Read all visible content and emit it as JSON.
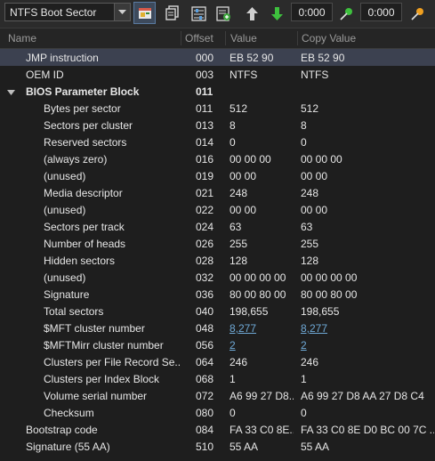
{
  "toolbar": {
    "template_select": "NTFS Boot Sector",
    "number_left": "0:000",
    "number_right": "0:000",
    "icons": [
      "template-icon",
      "copy-icon",
      "settings-icon",
      "export-icon",
      "up-icon",
      "down-icon",
      "pin-green-icon",
      "pin-orange-icon"
    ]
  },
  "columns": {
    "name": "Name",
    "offset": "Offset",
    "value": "Value",
    "copy_value": "Copy Value"
  },
  "rows": [
    {
      "name": "JMP instruction",
      "offset": "000",
      "value": "EB 52 90",
      "copy": "EB 52 90",
      "level": 1,
      "selected": true
    },
    {
      "name": "OEM ID",
      "offset": "003",
      "value": "NTFS",
      "copy": "NTFS",
      "level": 1
    },
    {
      "name": "BIOS Parameter Block",
      "offset": "011",
      "value": "",
      "copy": "",
      "level": 0,
      "group": true
    },
    {
      "name": "Bytes per sector",
      "offset": "011",
      "value": "512",
      "copy": "512",
      "level": 2
    },
    {
      "name": "Sectors per cluster",
      "offset": "013",
      "value": "8",
      "copy": "8",
      "level": 2
    },
    {
      "name": "Reserved sectors",
      "offset": "014",
      "value": "0",
      "copy": "0",
      "level": 2
    },
    {
      "name": "(always zero)",
      "offset": "016",
      "value": "00 00 00",
      "copy": "00 00 00",
      "level": 2
    },
    {
      "name": "(unused)",
      "offset": "019",
      "value": "00 00",
      "copy": "00 00",
      "level": 2
    },
    {
      "name": "Media descriptor",
      "offset": "021",
      "value": "248",
      "copy": "248",
      "level": 2
    },
    {
      "name": "(unused)",
      "offset": "022",
      "value": "00 00",
      "copy": "00 00",
      "level": 2
    },
    {
      "name": "Sectors per track",
      "offset": "024",
      "value": "63",
      "copy": "63",
      "level": 2
    },
    {
      "name": "Number of heads",
      "offset": "026",
      "value": "255",
      "copy": "255",
      "level": 2
    },
    {
      "name": "Hidden sectors",
      "offset": "028",
      "value": "128",
      "copy": "128",
      "level": 2
    },
    {
      "name": "(unused)",
      "offset": "032",
      "value": "00 00 00 00",
      "copy": "00 00 00 00",
      "level": 2
    },
    {
      "name": "Signature",
      "offset": "036",
      "value": "80 00 80 00",
      "copy": "80 00 80 00",
      "level": 2
    },
    {
      "name": "Total sectors",
      "offset": "040",
      "value": "198,655",
      "copy": "198,655",
      "level": 2
    },
    {
      "name": "$MFT cluster number",
      "offset": "048",
      "value": "8,277",
      "copy": "8,277",
      "level": 2,
      "link": true
    },
    {
      "name": "$MFTMirr cluster number",
      "offset": "056",
      "value": "2",
      "copy": "2",
      "level": 2,
      "link": true
    },
    {
      "name": "Clusters per File Record Se...",
      "offset": "064",
      "value": "246",
      "copy": "246",
      "level": 2
    },
    {
      "name": "Clusters per Index Block",
      "offset": "068",
      "value": "1",
      "copy": "1",
      "level": 2
    },
    {
      "name": "Volume serial number",
      "offset": "072",
      "value": "A6 99 27 D8...",
      "copy": "A6 99 27 D8 AA 27 D8 C4",
      "level": 2
    },
    {
      "name": "Checksum",
      "offset": "080",
      "value": "0",
      "copy": "0",
      "level": 2
    },
    {
      "name": "Bootstrap code",
      "offset": "084",
      "value": "FA 33 C0 8E...",
      "copy": "FA 33 C0 8E D0 BC 00 7C ...",
      "level": 1
    },
    {
      "name": "Signature (55 AA)",
      "offset": "510",
      "value": "55 AA",
      "copy": "55 AA",
      "level": 1
    }
  ]
}
